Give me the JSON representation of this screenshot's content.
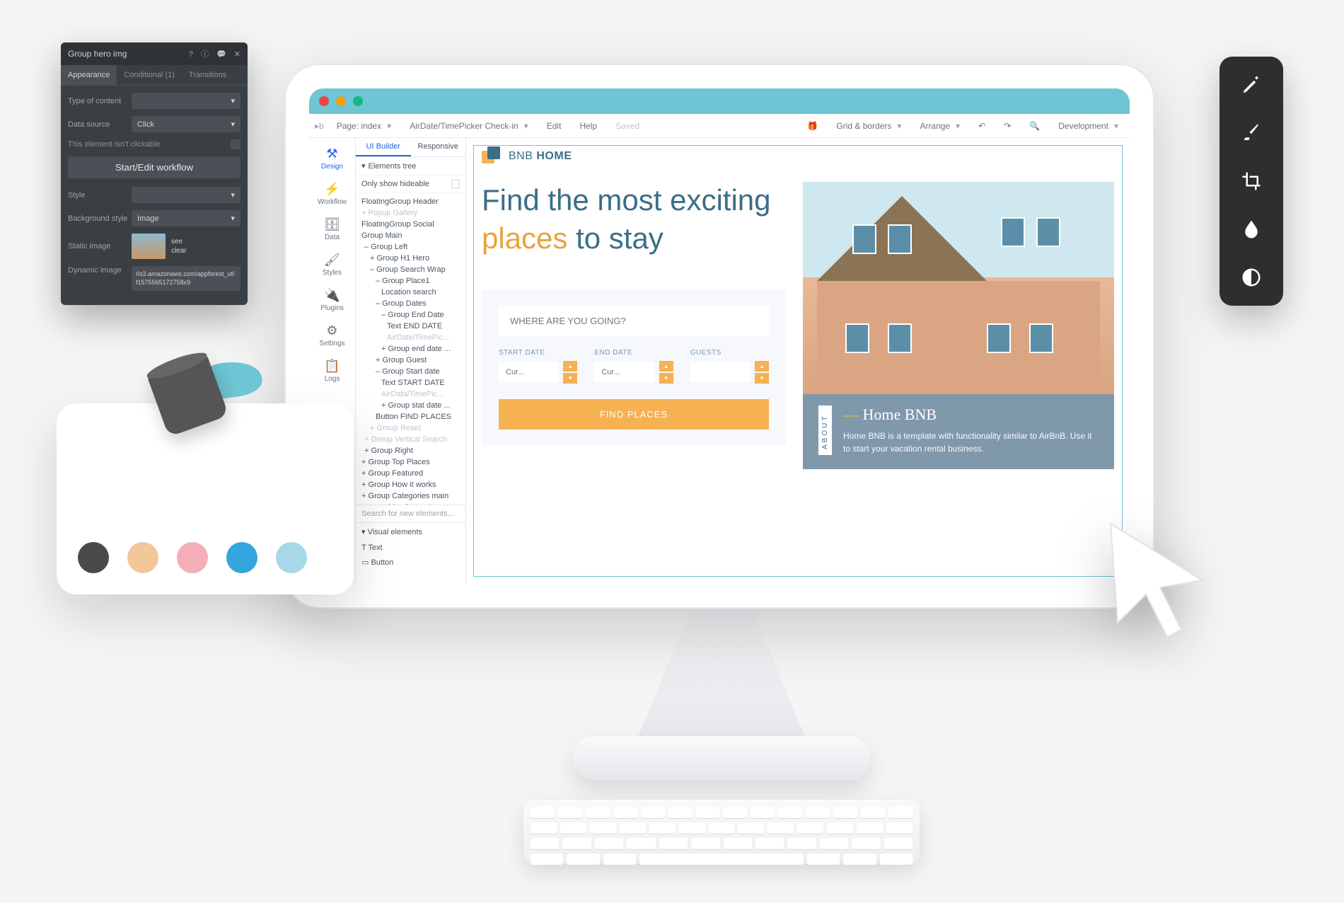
{
  "properties": {
    "title": "Group hero img",
    "tabs": [
      "Appearance",
      "Conditional (1)",
      "Transitions"
    ],
    "type_of_content_label": "Type of content",
    "type_of_content_value": "",
    "data_source_label": "Data source",
    "data_source_value": "Click",
    "not_clickable": "This element isn't clickable",
    "workflow_btn": "Start/Edit workflow",
    "style_label": "Style",
    "style_value": "",
    "bg_style_label": "Background style",
    "bg_style_value": "Image",
    "static_image_label": "Static image",
    "see": "see",
    "clear": "clear",
    "dynamic_image_label": "Dynamic image",
    "dynamic_image_value": "//s3.amazonaws.com/appforest_uf/f1575565172758x9"
  },
  "topbar": {
    "page_label": "Page: index",
    "element_label": "AirDate/TimePicker Check-in",
    "edit": "Edit",
    "help": "Help",
    "saved": "Saved",
    "grid": "Grid & borders",
    "arrange": "Arrange",
    "mode": "Development"
  },
  "rail": [
    "Design",
    "Workflow",
    "Data",
    "Styles",
    "Plugins",
    "Settings",
    "Logs"
  ],
  "rail_icons": [
    "✕",
    "☰",
    "≡",
    "✎",
    "⚙",
    "⚙",
    "≣"
  ],
  "panel": {
    "tabs": [
      "UI Builder",
      "Responsive"
    ],
    "section": "Elements tree",
    "only_hideable": "Only show hideable",
    "search_placeholder": "Search for new elements...",
    "visual_elements": "Visual elements",
    "ve_text": "Text",
    "ve_button": "Button",
    "tree": [
      {
        "t": "FloatingGroup Header",
        "i": 0
      },
      {
        "t": "+ Popup Gallery",
        "i": 0,
        "m": 1
      },
      {
        "t": "FloatingGroup Social",
        "i": 0
      },
      {
        "t": "Group Main",
        "i": 0
      },
      {
        "t": "– Group Left",
        "i": 1
      },
      {
        "t": "+ Group H1 Hero",
        "i": 2
      },
      {
        "t": "– Group Search Wrap",
        "i": 2
      },
      {
        "t": "– Group Place1",
        "i": 3
      },
      {
        "t": "Location search",
        "i": 4
      },
      {
        "t": "– Group Dates",
        "i": 3
      },
      {
        "t": "– Group End Date",
        "i": 4
      },
      {
        "t": "Text END DATE",
        "i": 5
      },
      {
        "t": "AirDate/TimePic...",
        "i": 5,
        "m": 1
      },
      {
        "t": "+ Group end date ...",
        "i": 4
      },
      {
        "t": "+ Group Guest",
        "i": 3
      },
      {
        "t": "– Group Start date",
        "i": 3
      },
      {
        "t": "Text START DATE",
        "i": 4
      },
      {
        "t": "AirData/TimePic...",
        "i": 4,
        "m": 1
      },
      {
        "t": "+ Group stat date ...",
        "i": 4
      },
      {
        "t": "Button FIND PLACES",
        "i": 3
      },
      {
        "t": "+ Group Reset",
        "i": 2,
        "m": 1
      },
      {
        "t": "+ Group Vertical Search",
        "i": 1,
        "m": 1
      },
      {
        "t": "+ Group Right",
        "i": 1
      },
      {
        "t": "+ Group Top Places",
        "i": 0
      },
      {
        "t": "+ Group Featured",
        "i": 0
      },
      {
        "t": "+ Group How it works",
        "i": 0
      },
      {
        "t": "+ Group Categories main",
        "i": 0
      },
      {
        "t": "new_white_footer A",
        "i": 1
      }
    ]
  },
  "canvas": {
    "brand_pre": "BNB",
    "brand_post": "HOME",
    "hero_line1": "Find the most exciting",
    "hero_accent": "places",
    "hero_line2": " to stay",
    "search_placeholder": "WHERE ARE YOU GOING?",
    "start_date": "START DATE",
    "end_date": "END DATE",
    "guests": "GUESTS",
    "cur": "Cur...",
    "find_btn": "FIND PLACES",
    "about_label": "ABOUT",
    "about_title": "Home BNB",
    "about_desc": "Home BNB is a template with functionality similar to AirBnB. Use it to start your vacation rental business."
  },
  "palette": [
    "#4a4a4a",
    "#f2c89a",
    "#f4aeb8",
    "#33a6dd",
    "#a8d8e8"
  ]
}
